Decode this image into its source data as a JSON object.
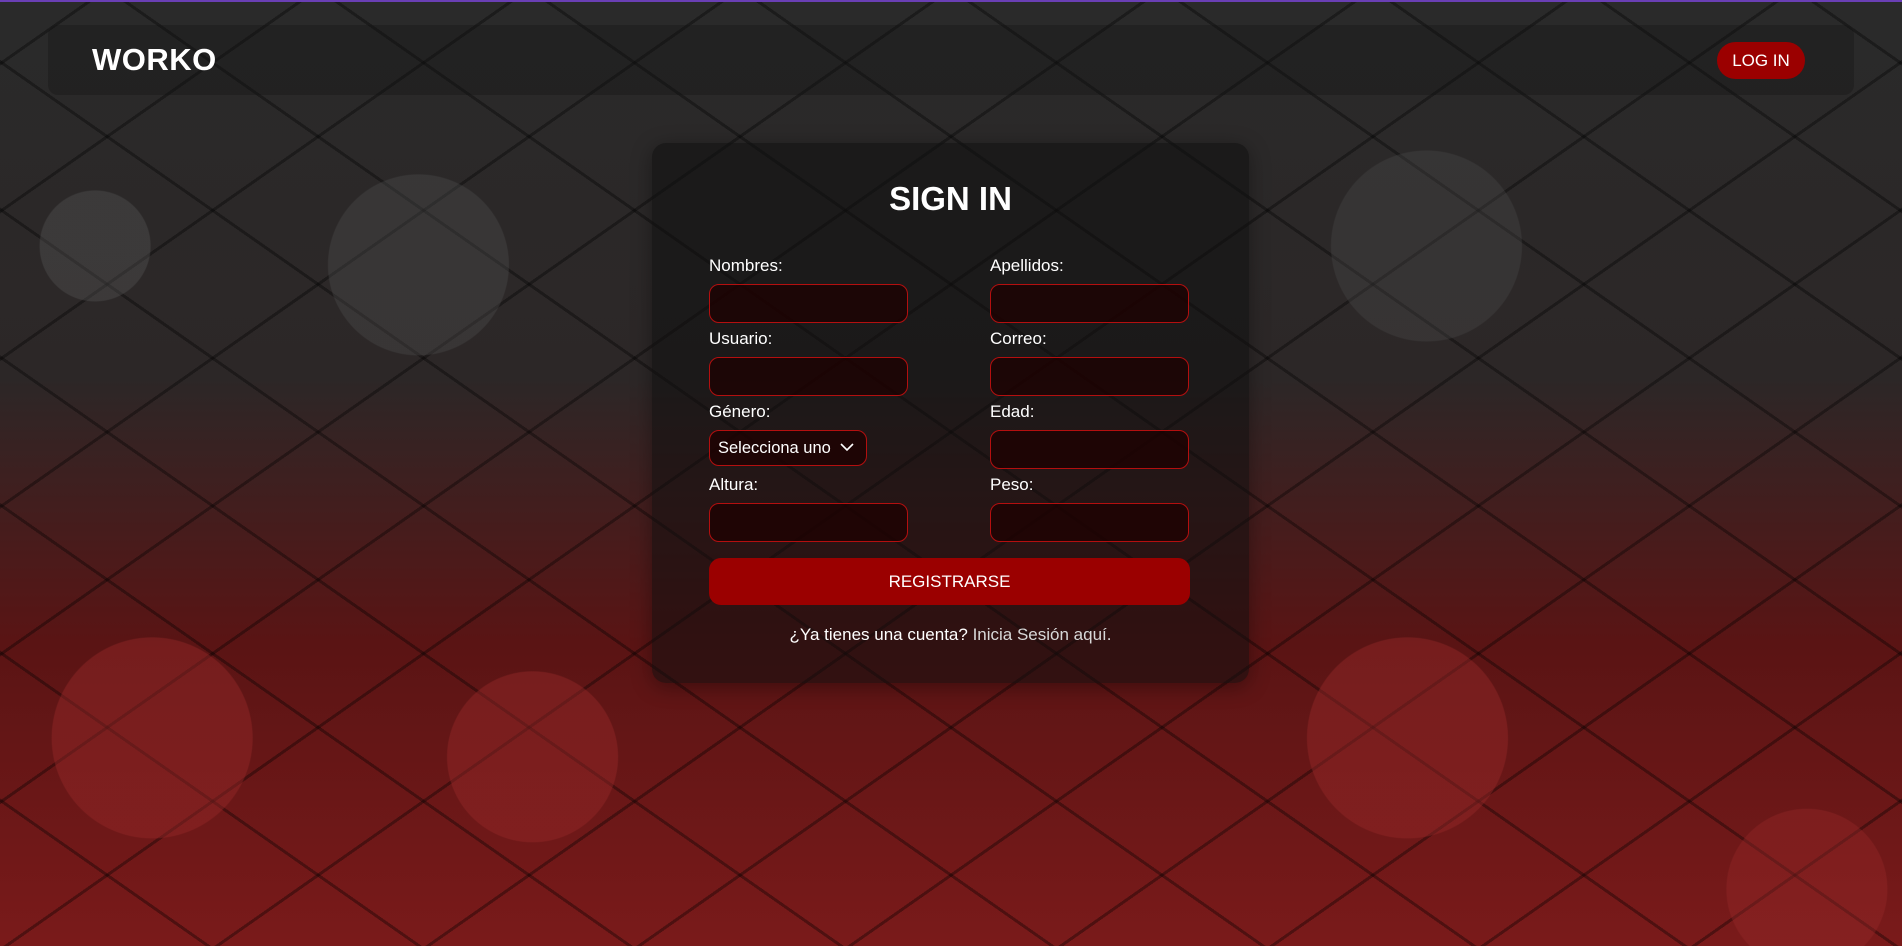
{
  "header": {
    "logo": "WORKO",
    "login_button": "LOG IN"
  },
  "form": {
    "title": "SIGN IN",
    "fields": {
      "nombres": {
        "label": "Nombres:",
        "value": ""
      },
      "apellidos": {
        "label": "Apellidos:",
        "value": ""
      },
      "usuario": {
        "label": "Usuario:",
        "value": ""
      },
      "correo": {
        "label": "Correo:",
        "value": ""
      },
      "genero": {
        "label": "Género:",
        "selected": "Selecciona uno"
      },
      "edad": {
        "label": "Edad:",
        "value": ""
      },
      "altura": {
        "label": "Altura:",
        "value": ""
      },
      "peso": {
        "label": "Peso:",
        "value": ""
      }
    },
    "submit_button": "REGISTRARSE",
    "footer": {
      "question": "¿Ya tienes una cuenta?",
      "link": "Inicia Sesión aquí."
    }
  },
  "colors": {
    "accent": "#9b0000",
    "field_border": "#b40f0f",
    "top_line": "#6a3fb5"
  },
  "icons": {
    "select_arrow": "chevron-down-icon"
  }
}
